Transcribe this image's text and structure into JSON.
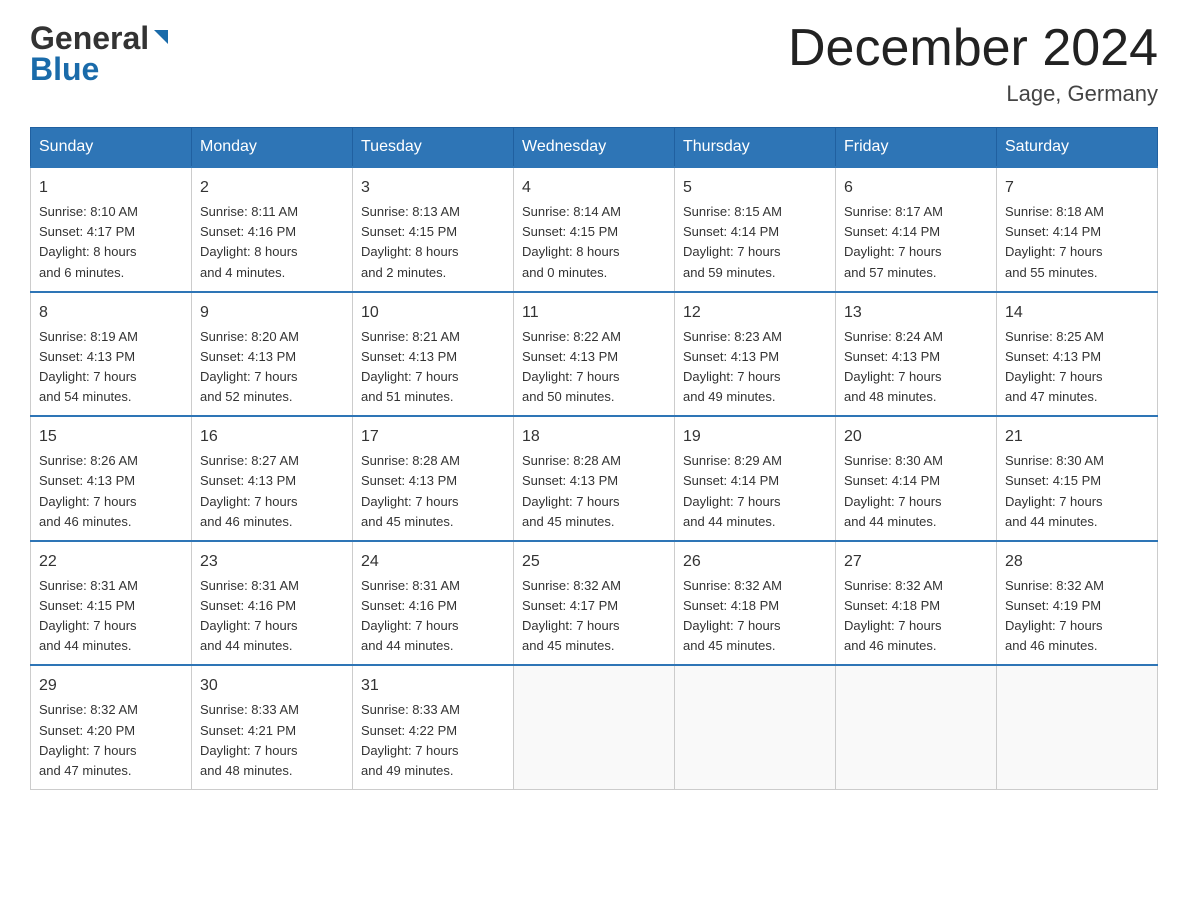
{
  "header": {
    "logo_general": "General",
    "logo_blue": "Blue",
    "month_title": "December 2024",
    "location": "Lage, Germany"
  },
  "weekdays": [
    "Sunday",
    "Monday",
    "Tuesday",
    "Wednesday",
    "Thursday",
    "Friday",
    "Saturday"
  ],
  "weeks": [
    [
      {
        "day": "1",
        "sunrise": "8:10 AM",
        "sunset": "4:17 PM",
        "daylight": "8 hours and 6 minutes."
      },
      {
        "day": "2",
        "sunrise": "8:11 AM",
        "sunset": "4:16 PM",
        "daylight": "8 hours and 4 minutes."
      },
      {
        "day": "3",
        "sunrise": "8:13 AM",
        "sunset": "4:15 PM",
        "daylight": "8 hours and 2 minutes."
      },
      {
        "day": "4",
        "sunrise": "8:14 AM",
        "sunset": "4:15 PM",
        "daylight": "8 hours and 0 minutes."
      },
      {
        "day": "5",
        "sunrise": "8:15 AM",
        "sunset": "4:14 PM",
        "daylight": "7 hours and 59 minutes."
      },
      {
        "day": "6",
        "sunrise": "8:17 AM",
        "sunset": "4:14 PM",
        "daylight": "7 hours and 57 minutes."
      },
      {
        "day": "7",
        "sunrise": "8:18 AM",
        "sunset": "4:14 PM",
        "daylight": "7 hours and 55 minutes."
      }
    ],
    [
      {
        "day": "8",
        "sunrise": "8:19 AM",
        "sunset": "4:13 PM",
        "daylight": "7 hours and 54 minutes."
      },
      {
        "day": "9",
        "sunrise": "8:20 AM",
        "sunset": "4:13 PM",
        "daylight": "7 hours and 52 minutes."
      },
      {
        "day": "10",
        "sunrise": "8:21 AM",
        "sunset": "4:13 PM",
        "daylight": "7 hours and 51 minutes."
      },
      {
        "day": "11",
        "sunrise": "8:22 AM",
        "sunset": "4:13 PM",
        "daylight": "7 hours and 50 minutes."
      },
      {
        "day": "12",
        "sunrise": "8:23 AM",
        "sunset": "4:13 PM",
        "daylight": "7 hours and 49 minutes."
      },
      {
        "day": "13",
        "sunrise": "8:24 AM",
        "sunset": "4:13 PM",
        "daylight": "7 hours and 48 minutes."
      },
      {
        "day": "14",
        "sunrise": "8:25 AM",
        "sunset": "4:13 PM",
        "daylight": "7 hours and 47 minutes."
      }
    ],
    [
      {
        "day": "15",
        "sunrise": "8:26 AM",
        "sunset": "4:13 PM",
        "daylight": "7 hours and 46 minutes."
      },
      {
        "day": "16",
        "sunrise": "8:27 AM",
        "sunset": "4:13 PM",
        "daylight": "7 hours and 46 minutes."
      },
      {
        "day": "17",
        "sunrise": "8:28 AM",
        "sunset": "4:13 PM",
        "daylight": "7 hours and 45 minutes."
      },
      {
        "day": "18",
        "sunrise": "8:28 AM",
        "sunset": "4:13 PM",
        "daylight": "7 hours and 45 minutes."
      },
      {
        "day": "19",
        "sunrise": "8:29 AM",
        "sunset": "4:14 PM",
        "daylight": "7 hours and 44 minutes."
      },
      {
        "day": "20",
        "sunrise": "8:30 AM",
        "sunset": "4:14 PM",
        "daylight": "7 hours and 44 minutes."
      },
      {
        "day": "21",
        "sunrise": "8:30 AM",
        "sunset": "4:15 PM",
        "daylight": "7 hours and 44 minutes."
      }
    ],
    [
      {
        "day": "22",
        "sunrise": "8:31 AM",
        "sunset": "4:15 PM",
        "daylight": "7 hours and 44 minutes."
      },
      {
        "day": "23",
        "sunrise": "8:31 AM",
        "sunset": "4:16 PM",
        "daylight": "7 hours and 44 minutes."
      },
      {
        "day": "24",
        "sunrise": "8:31 AM",
        "sunset": "4:16 PM",
        "daylight": "7 hours and 44 minutes."
      },
      {
        "day": "25",
        "sunrise": "8:32 AM",
        "sunset": "4:17 PM",
        "daylight": "7 hours and 45 minutes."
      },
      {
        "day": "26",
        "sunrise": "8:32 AM",
        "sunset": "4:18 PM",
        "daylight": "7 hours and 45 minutes."
      },
      {
        "day": "27",
        "sunrise": "8:32 AM",
        "sunset": "4:18 PM",
        "daylight": "7 hours and 46 minutes."
      },
      {
        "day": "28",
        "sunrise": "8:32 AM",
        "sunset": "4:19 PM",
        "daylight": "7 hours and 46 minutes."
      }
    ],
    [
      {
        "day": "29",
        "sunrise": "8:32 AM",
        "sunset": "4:20 PM",
        "daylight": "7 hours and 47 minutes."
      },
      {
        "day": "30",
        "sunrise": "8:33 AM",
        "sunset": "4:21 PM",
        "daylight": "7 hours and 48 minutes."
      },
      {
        "day": "31",
        "sunrise": "8:33 AM",
        "sunset": "4:22 PM",
        "daylight": "7 hours and 49 minutes."
      },
      null,
      null,
      null,
      null
    ]
  ],
  "labels": {
    "sunrise": "Sunrise:",
    "sunset": "Sunset:",
    "daylight": "Daylight:"
  }
}
